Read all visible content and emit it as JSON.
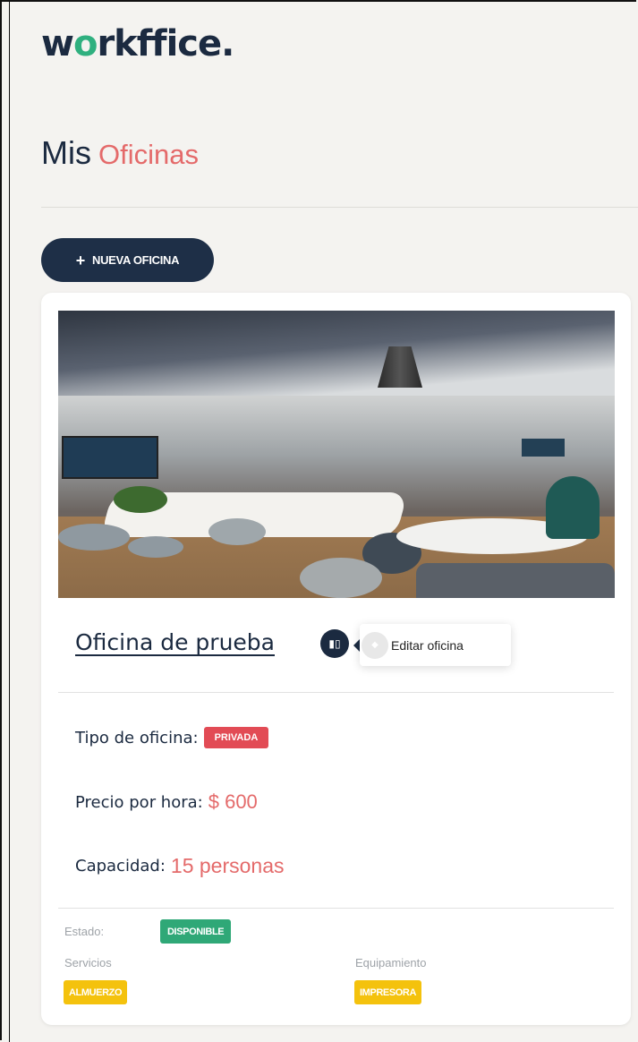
{
  "brand": {
    "logo_text_start": "w",
    "logo_text_o": "o",
    "logo_text_end": "rkffice."
  },
  "page": {
    "title_primary": "Mis",
    "title_accent": "Oficinas"
  },
  "toolbar": {
    "new_office_icon": "plus-icon",
    "new_office_label": "NUEVA OFICINA"
  },
  "office": {
    "name": "Oficina de prueba",
    "edit_icon": "edit-icon",
    "tooltip_label": "Editar oficina",
    "type_label": "Tipo de oficina:",
    "type_value": "PRIVADA",
    "price_label": "Precio por hora:",
    "price_value": "$ 600",
    "capacity_label": "Capacidad:",
    "capacity_value": "15 personas",
    "status_label": "Estado:",
    "status_value": "DISPONIBLE",
    "services_label": "Servicios",
    "services": [
      "ALMUERZO"
    ],
    "equipment_label": "Equipamiento",
    "equipment": [
      "IMPRESORA"
    ]
  },
  "colors": {
    "navy": "#1e2f47",
    "accent_red": "#e46a6a",
    "badge_red": "#e24b55",
    "badge_green": "#2fa877",
    "badge_yellow": "#f4c20d"
  }
}
